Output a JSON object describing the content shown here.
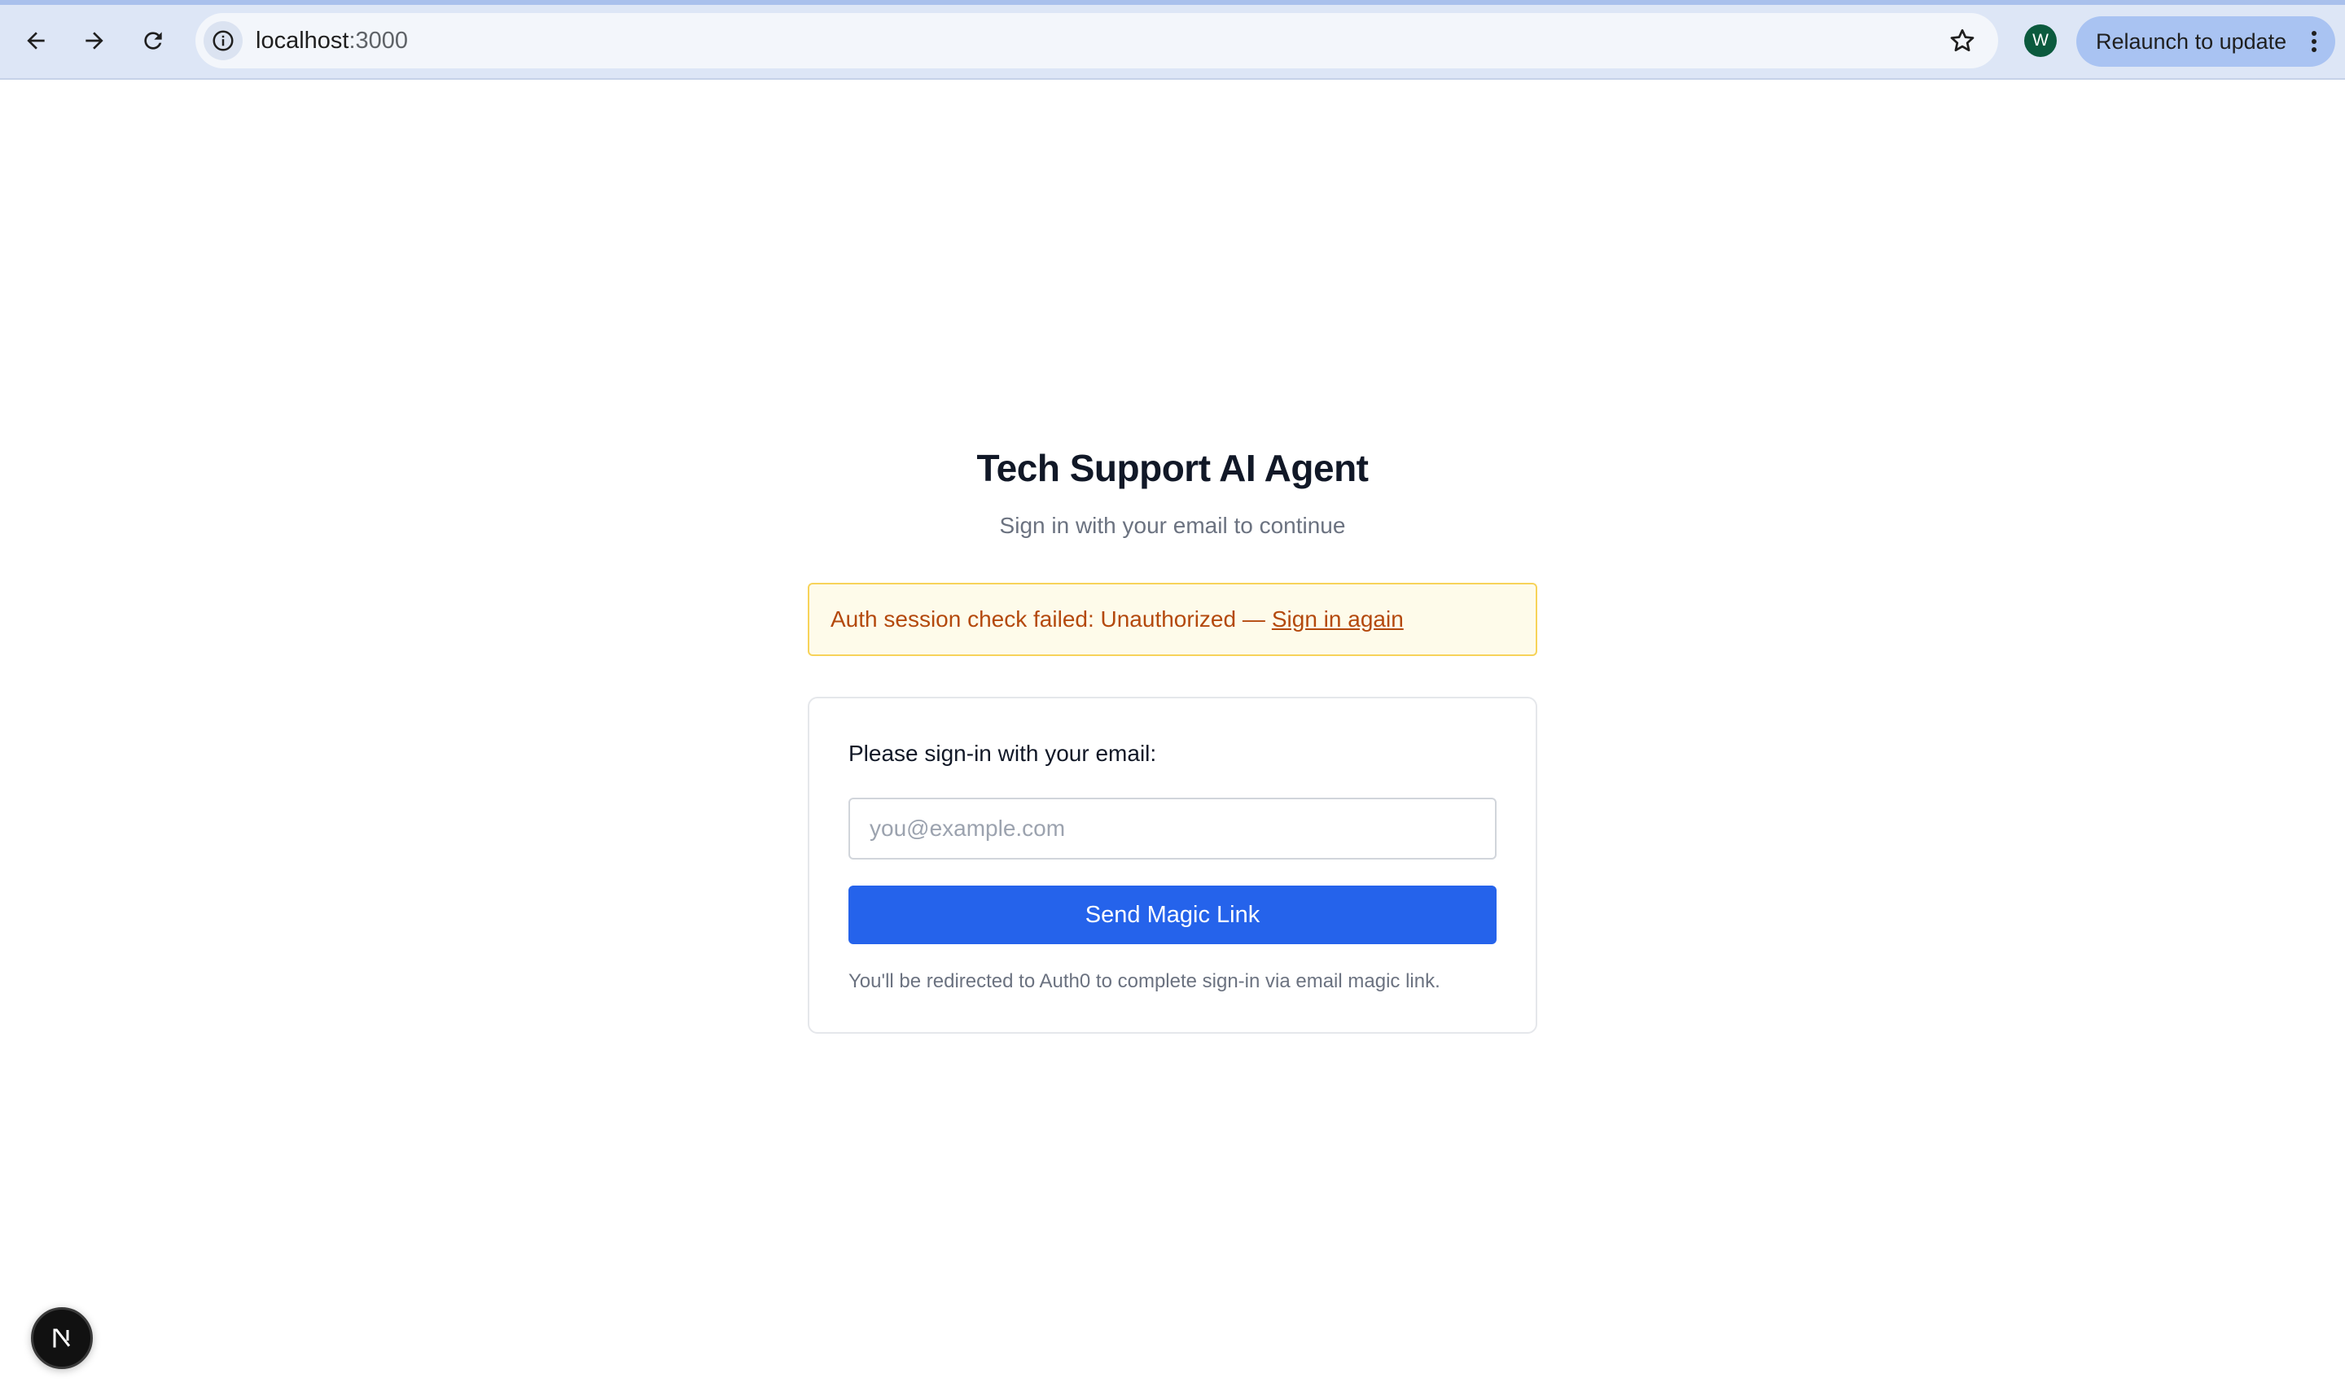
{
  "browser": {
    "url_host": "localhost",
    "url_port": ":3000",
    "profile_initial": "W",
    "relaunch_label": "Relaunch to update",
    "icons": [
      "back-arrow-icon",
      "forward-arrow-icon",
      "reload-icon",
      "site-info-icon",
      "bookmark-star-icon",
      "more-vert-icon"
    ]
  },
  "page": {
    "title": "Tech Support AI Agent",
    "subtitle": "Sign in with your email to continue"
  },
  "alert": {
    "message": "Auth session check failed: Unauthorized —",
    "link_label": "Sign in again",
    "text_color": "#b4490d",
    "border_color": "#f7d35a"
  },
  "signin_card": {
    "label": "Please sign-in with your email:",
    "email_placeholder": "you@example.com",
    "email_value": "",
    "button_label": "Send Magic Link",
    "note": "You'll be redirected to Auth0 to complete sign-in via email magic link.",
    "accent_color": "#2563eb"
  },
  "dev_badge": {
    "letter": "N",
    "icon": "nextjs-logo-icon"
  }
}
